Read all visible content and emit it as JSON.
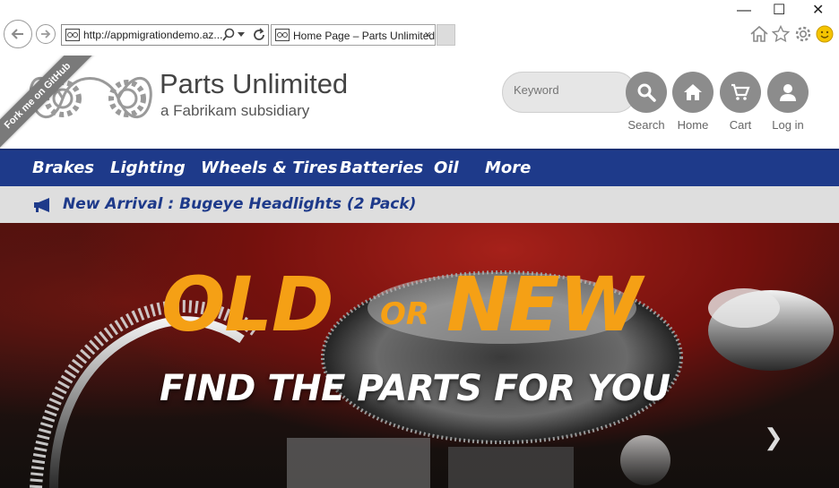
{
  "browser": {
    "url": "http://appmigrationdemo.az...",
    "tab_title": "Home Page – Parts Unlimited",
    "tab_close": "×",
    "window_controls": {
      "minimize": "—",
      "maximize": "☐",
      "close": "✕"
    }
  },
  "site": {
    "brand": "Parts Unlimited",
    "tagline": "a Fabrikam subsidiary",
    "ribbon": "Fork me on GitHub",
    "search": {
      "placeholder": "Keyword",
      "label": "Search"
    },
    "actions": {
      "home": "Home",
      "cart": "Cart",
      "login": "Log in"
    },
    "nav": [
      "Brakes",
      "Lighting",
      "Wheels & Tires",
      "Batteries",
      "Oil",
      "More"
    ],
    "promo": "New Arrival : Bugeye Headlights (2 Pack)",
    "hero": {
      "line1_a": "OLD",
      "line1_or": "OR",
      "line1_b": "NEW",
      "line2": "FIND THE PARTS FOR YOU",
      "next": "❯"
    }
  },
  "colors": {
    "nav": "#1e3a8a",
    "accent": "#f5a015",
    "button": "#8c8c8c"
  },
  "icons": [
    "back-icon",
    "forward-icon",
    "search-icon",
    "refresh-icon",
    "home-icon",
    "star-icon",
    "gear-icon",
    "smiley-icon",
    "cart-icon",
    "user-icon",
    "megaphone-icon"
  ]
}
